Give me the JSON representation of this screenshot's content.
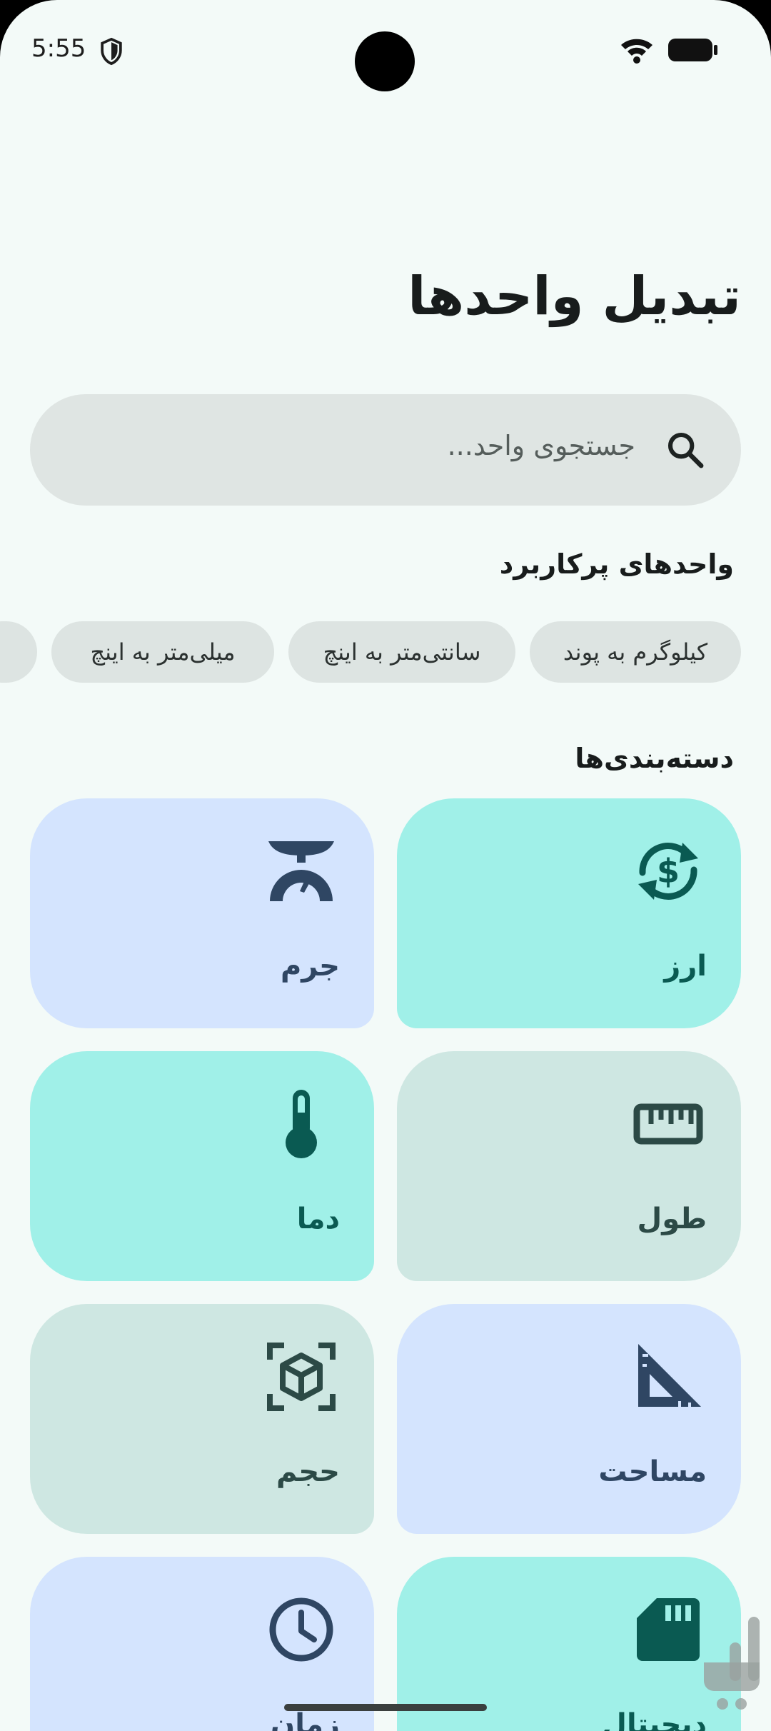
{
  "status_bar": {
    "time": "5:55"
  },
  "header": {
    "title": "تبدیل واحدها"
  },
  "search": {
    "placeholder": "جستجوی واحد..."
  },
  "popular": {
    "title": "واحدهای پرکاربرد",
    "chips": [
      "کیلوگرم به پوند",
      "سانتی‌متر به اینچ",
      "میلی‌متر به اینچ"
    ]
  },
  "categories": {
    "title": "دسته‌بندی‌ها",
    "items": [
      {
        "label": "ارز",
        "icon": "currency-exchange-icon"
      },
      {
        "label": "جرم",
        "icon": "scale-icon"
      },
      {
        "label": "طول",
        "icon": "ruler-icon"
      },
      {
        "label": "دما",
        "icon": "thermometer-icon"
      },
      {
        "label": "مساحت",
        "icon": "set-square-icon"
      },
      {
        "label": "حجم",
        "icon": "cube-icon"
      },
      {
        "label": "دیجیتال",
        "icon": "sd-card-icon"
      },
      {
        "label": "زمان",
        "icon": "clock-icon"
      }
    ]
  },
  "colors": {
    "background": "#f3faf8",
    "card_teal": "#a0f0e8",
    "card_blue": "#d4e4fe",
    "card_sage": "#cee7e2",
    "icon_dark_teal": "#0a5a52",
    "icon_navy": "#2f4663"
  }
}
